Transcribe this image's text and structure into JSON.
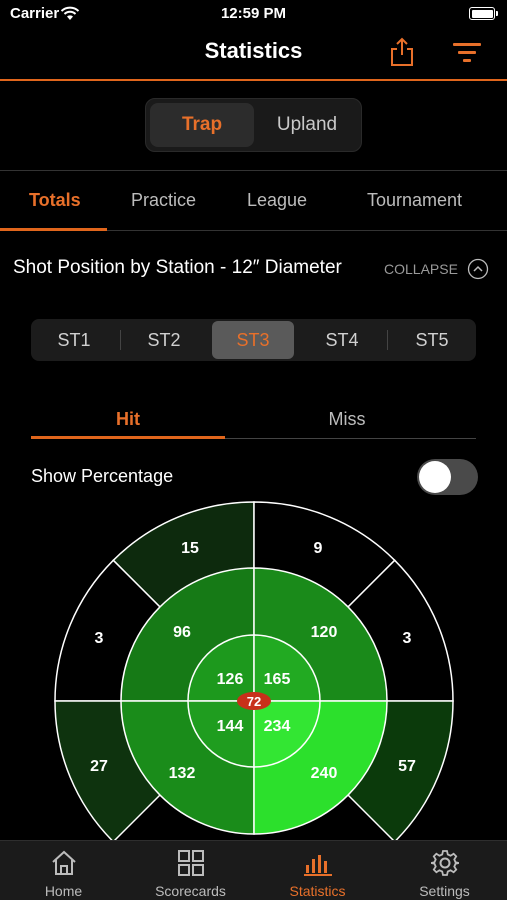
{
  "status": {
    "carrier": "Carrier",
    "time": "12:59 PM"
  },
  "nav": {
    "title": "Statistics",
    "share_icon": "share-icon",
    "filter_icon": "filter-icon"
  },
  "segment": {
    "options": [
      "Trap",
      "Upland"
    ],
    "selected": "Trap"
  },
  "tabs": {
    "items": [
      "Totals",
      "Practice",
      "League",
      "Tournament"
    ],
    "selected": "Totals"
  },
  "section": {
    "title": "Shot Position by Station - 12″ Diameter",
    "collapse": "COLLAPSE"
  },
  "stations": {
    "items": [
      "ST1",
      "ST2",
      "ST3",
      "ST4",
      "ST5"
    ],
    "selected": "ST3"
  },
  "hitmiss": {
    "hit": "Hit",
    "miss": "Miss",
    "selected": "Hit"
  },
  "show_percentage": {
    "label": "Show Percentage",
    "on": false
  },
  "target": {
    "center": "72",
    "inner": {
      "top_left": "126",
      "top_right": "165",
      "bottom_left": "144",
      "bottom_right": "234"
    },
    "middle": {
      "top_left": "96",
      "top_right": "120",
      "bottom_left": "132",
      "bottom_right": "240"
    },
    "outer": {
      "top_left": "15",
      "top_right": "9",
      "left_upper": "3",
      "right_upper": "3",
      "left_lower": "27",
      "right_lower": "57"
    },
    "colors": {
      "accent": "#e0661c",
      "center_badge": "#c8301a"
    }
  },
  "tabbar": {
    "items": [
      {
        "label": "Home",
        "icon": "home-icon"
      },
      {
        "label": "Scorecards",
        "icon": "grid-icon"
      },
      {
        "label": "Statistics",
        "icon": "bar-chart-icon"
      },
      {
        "label": "Settings",
        "icon": "gear-icon"
      }
    ],
    "selected": "Statistics"
  }
}
